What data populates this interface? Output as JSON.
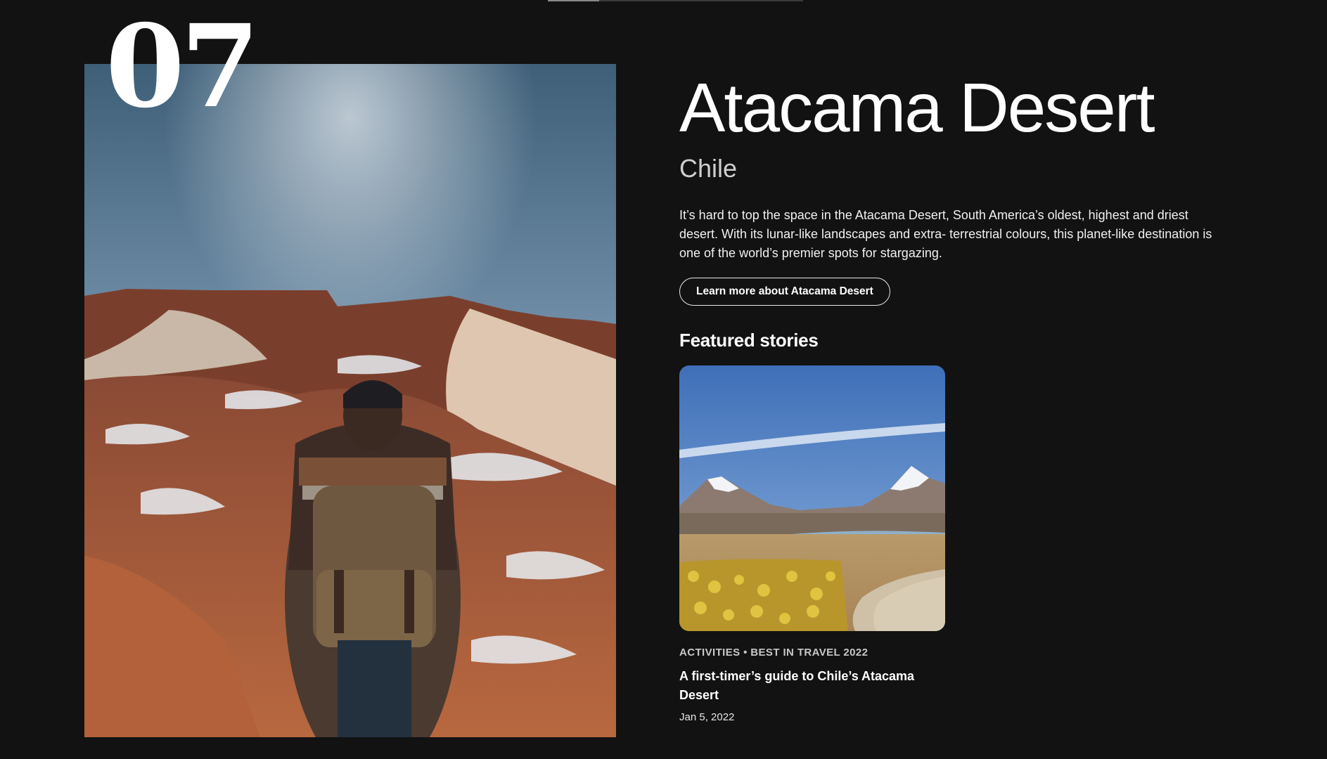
{
  "progress": {
    "fraction": 0.2
  },
  "rank": "07",
  "destination": {
    "title": "Atacama Desert",
    "country": "Chile",
    "description": "It’s hard to top the space in the Atacama Desert, South America’s oldest, highest and driest desert. With its lunar-like landscapes and extra- terrestrial colours, this planet-like destination is one of the world’s premier spots for stargazing.",
    "cta_label": "Learn more about Atacama Desert"
  },
  "featured": {
    "heading": "Featured stories",
    "stories": [
      {
        "tags": "ACTIVITIES • BEST IN TRAVEL 2022",
        "title": "A first-timer’s guide to Chile’s Atacama Desert",
        "date": "Jan 5, 2022"
      }
    ]
  },
  "colors": {
    "background": "#121212",
    "text": "#ffffff",
    "muted_text": "#cfcfcf"
  }
}
